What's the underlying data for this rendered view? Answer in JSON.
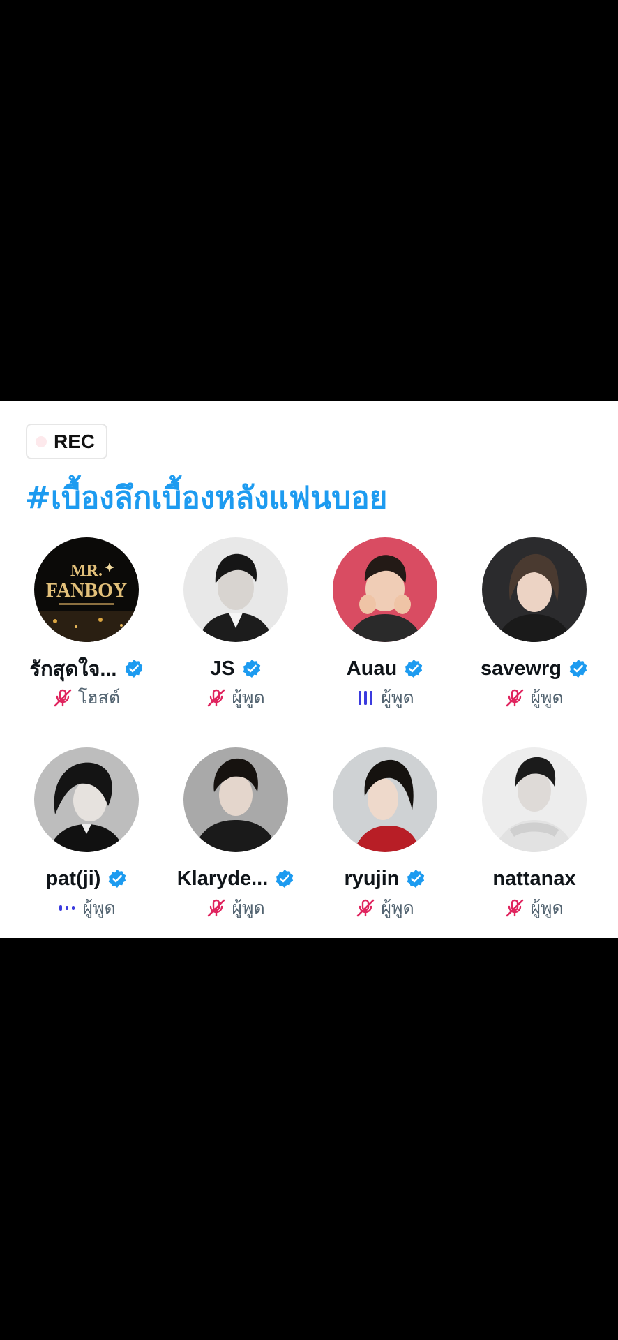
{
  "space": {
    "recording_label": "REC",
    "title": "#เบื้องลึกเบื้องหลังแฟนบอย"
  },
  "colors": {
    "title": "#1d9bf0",
    "verified": "#1d9bf0",
    "muted": "#e0245e",
    "speaking": "#3b3bde"
  },
  "participants": [
    {
      "name": "รักสุดใจ...",
      "verified": true,
      "status": "muted",
      "role": "โฮสต์",
      "avatar": "mr-fanboy-logo"
    },
    {
      "name": "JS",
      "verified": true,
      "status": "muted",
      "role": "ผู้พูด",
      "avatar": "person-photo"
    },
    {
      "name": "Auau",
      "verified": true,
      "status": "speaking",
      "role": "ผู้พูด",
      "avatar": "person-photo"
    },
    {
      "name": "savewrg",
      "verified": true,
      "status": "muted",
      "role": "ผู้พูด",
      "avatar": "person-photo"
    },
    {
      "name": "pat(ji)",
      "verified": true,
      "status": "connecting",
      "role": "ผู้พูด",
      "avatar": "person-photo"
    },
    {
      "name": "Klaryde...",
      "verified": true,
      "status": "muted",
      "role": "ผู้พูด",
      "avatar": "person-photo"
    },
    {
      "name": "ryujin",
      "verified": true,
      "status": "muted",
      "role": "ผู้พูด",
      "avatar": "person-photo"
    },
    {
      "name": "nattanax",
      "verified": false,
      "status": "muted",
      "role": "ผู้พูด",
      "avatar": "person-photo"
    }
  ]
}
